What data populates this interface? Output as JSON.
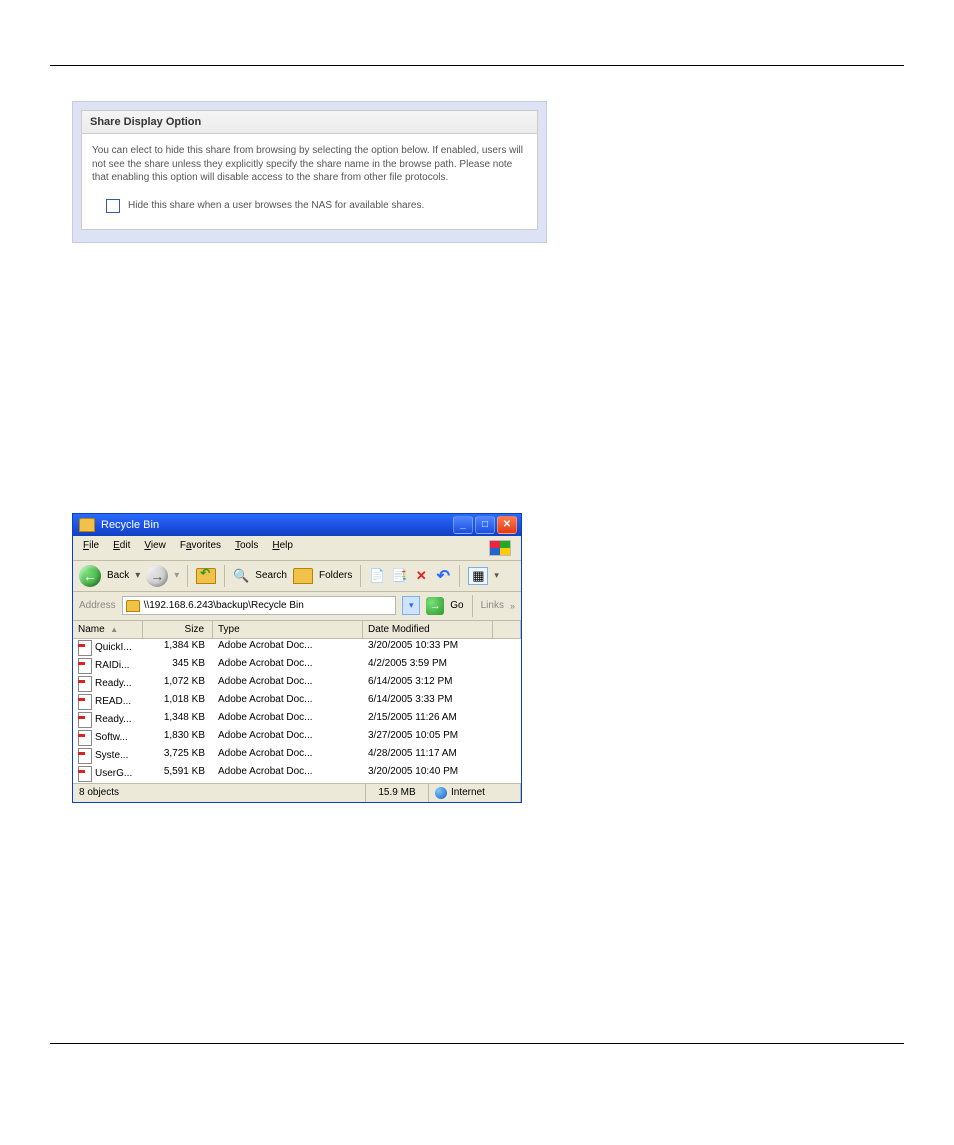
{
  "panel1": {
    "heading": "Share Display Option",
    "desc": "You can elect to hide this share from browsing by selecting the option below. If enabled, users will not see the share unless they explicitly specify the share name in the browse path. Please note that enabling this option will disable access to the share from other file protocols.",
    "checkbox_label": "Hide this share when a user browses the NAS for available shares."
  },
  "explorer": {
    "title": "Recycle Bin",
    "menu": {
      "file": "File",
      "edit": "Edit",
      "view": "View",
      "favorites": "Favorites",
      "tools": "Tools",
      "help": "Help"
    },
    "toolbar": {
      "back": "Back",
      "search": "Search",
      "folders": "Folders"
    },
    "address": {
      "label": "Address",
      "path": "\\\\192.168.6.243\\backup\\Recycle Bin",
      "go": "Go",
      "links": "Links"
    },
    "columns": {
      "name": "Name",
      "sort": "▲",
      "size": "Size",
      "type": "Type",
      "modified": "Date Modified"
    },
    "rows": [
      {
        "name": "QuickI...",
        "size": "1,384 KB",
        "type": "Adobe Acrobat Doc...",
        "modified": "3/20/2005 10:33 PM"
      },
      {
        "name": "RAIDi...",
        "size": "345 KB",
        "type": "Adobe Acrobat Doc...",
        "modified": "4/2/2005 3:59 PM"
      },
      {
        "name": "Ready...",
        "size": "1,072 KB",
        "type": "Adobe Acrobat Doc...",
        "modified": "6/14/2005 3:12 PM"
      },
      {
        "name": "READ...",
        "size": "1,018 KB",
        "type": "Adobe Acrobat Doc...",
        "modified": "6/14/2005 3:33 PM"
      },
      {
        "name": "Ready...",
        "size": "1,348 KB",
        "type": "Adobe Acrobat Doc...",
        "modified": "2/15/2005 11:26 AM"
      },
      {
        "name": "Softw...",
        "size": "1,830 KB",
        "type": "Adobe Acrobat Doc...",
        "modified": "3/27/2005 10:05 PM"
      },
      {
        "name": "Syste...",
        "size": "3,725 KB",
        "type": "Adobe Acrobat Doc...",
        "modified": "4/28/2005 11:17 AM"
      },
      {
        "name": "UserG...",
        "size": "5,591 KB",
        "type": "Adobe Acrobat Doc...",
        "modified": "3/20/2005 10:40 PM"
      }
    ],
    "status": {
      "objects": "8 objects",
      "size": "15.9 MB",
      "zone": "Internet"
    }
  }
}
